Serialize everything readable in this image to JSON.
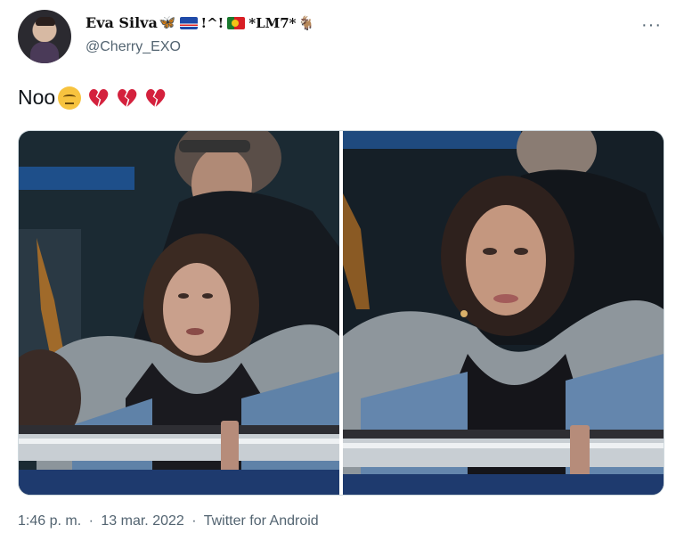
{
  "author": {
    "display_name": "Eva Silva",
    "name_symbols": "!^!",
    "name_suffix": "*LM7*",
    "handle": "@Cherry_EXO",
    "icons": [
      "butterfly-emoji",
      "flag-cape-verde",
      "flag-portugal",
      "goat-emoji"
    ]
  },
  "menu": {
    "more_label": "···"
  },
  "tweet": {
    "text": "Noo",
    "emojis": [
      "pensive-face",
      "broken-heart",
      "broken-heart",
      "broken-heart"
    ]
  },
  "media": {
    "count": 2,
    "photos": [
      {
        "subject": "woman in grey fur-hood denim jacket at stadium, biting lip"
      },
      {
        "subject": "woman in grey fur-hood denim jacket at stadium, serious expression"
      }
    ]
  },
  "meta": {
    "time": "1:46 p. m.",
    "sep1": "·",
    "date": "13 mar. 2022",
    "sep2": "·",
    "source": "Twitter for Android"
  },
  "colors": {
    "text": "#0f1419",
    "secondary": "#536471",
    "heart": "#e0245e"
  }
}
